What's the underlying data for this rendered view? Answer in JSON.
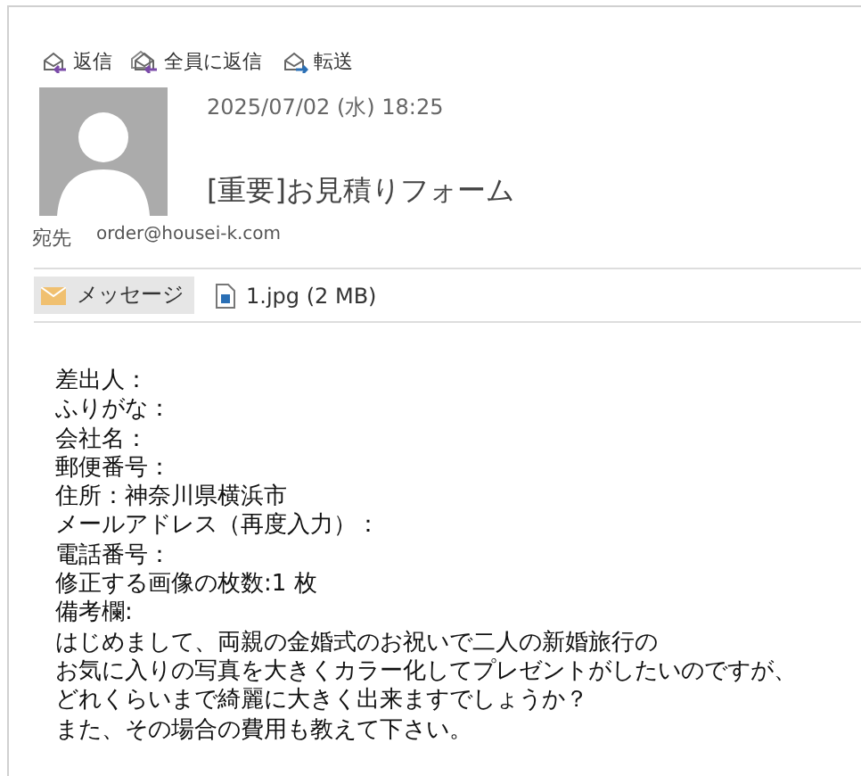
{
  "actions": [
    {
      "kind": "reply",
      "label": "返信"
    },
    {
      "kind": "reply_all",
      "label": "全員に返信"
    },
    {
      "kind": "forward",
      "label": "転送"
    }
  ],
  "header": {
    "date": "2025/07/02 (水) 18:25",
    "subject": "[重要]お見積りフォーム",
    "to_label": "宛先",
    "to": "order@housei-k.com"
  },
  "attachments": [
    {
      "kind": "message",
      "label": "メッセージ",
      "selected": true
    },
    {
      "kind": "file",
      "label": "1.jpg (2 MB)",
      "selected": false
    }
  ],
  "body": [
    "差出人：",
    "ふりがな：",
    "会社名：",
    "郵便番号：",
    "住所：神奈川県横浜市",
    "メールアドレス（再度入力）：",
    "電話番号：",
    "修正する画像の枚数:1 枚",
    "備考欄:",
    "はじめまして、両親の金婚式のお祝いで二人の新婚旅行の",
    "お気に入りの写真を大きくカラー化してプレゼントがしたいのですが、",
    "どれくらいまで綺麗に大きく出来ますでしょうか？",
    "また、その場合の費用も教えて下さい。"
  ]
}
